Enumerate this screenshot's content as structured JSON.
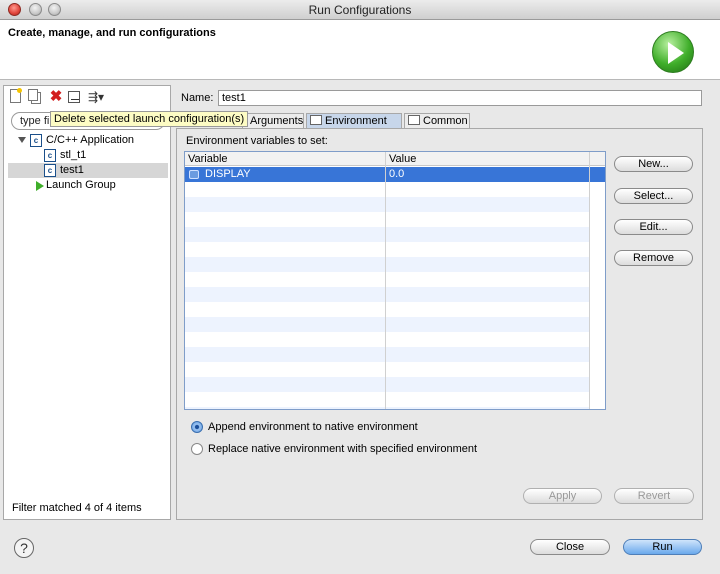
{
  "window": {
    "title": "Run Configurations"
  },
  "header": {
    "title": "Create, manage, and run configurations"
  },
  "left_panel": {
    "filter_text": "type fil",
    "tooltip": "Delete selected launch configuration(s)",
    "tree": [
      {
        "label": "C/C++ Application",
        "icon": "c-application-icon",
        "level": 0,
        "expanded": true
      },
      {
        "label": "stl_t1",
        "icon": "c-file-icon",
        "level": 1
      },
      {
        "label": "test1",
        "icon": "c-file-icon",
        "level": 1,
        "selected": true
      },
      {
        "label": "Launch Group",
        "icon": "launch-group-icon",
        "level": 0
      }
    ],
    "status": "Filter matched 4 of 4 items"
  },
  "config": {
    "name_label": "Name:",
    "name_value": "test1",
    "tabs": [
      "Arguments",
      "Environment",
      "Common"
    ],
    "active_tab": "Environment"
  },
  "environment": {
    "label": "Environment variables to set:",
    "columns": [
      "Variable",
      "Value"
    ],
    "rows": [
      {
        "variable": "DISPLAY",
        "value": "0.0"
      }
    ],
    "buttons": {
      "new": "New...",
      "select": "Select...",
      "edit": "Edit...",
      "remove": "Remove"
    },
    "mode_options": [
      "Append environment to native environment",
      "Replace native environment with specified environment"
    ],
    "selected_mode": 0
  },
  "actions": {
    "apply": "Apply",
    "revert": "Revert",
    "close": "Close",
    "run": "Run"
  },
  "colors": {
    "selection": "#3875d7",
    "row_stripe": "#edf3fe",
    "active_tab": "#c7d6ea",
    "run_green": "#3fae2a"
  }
}
